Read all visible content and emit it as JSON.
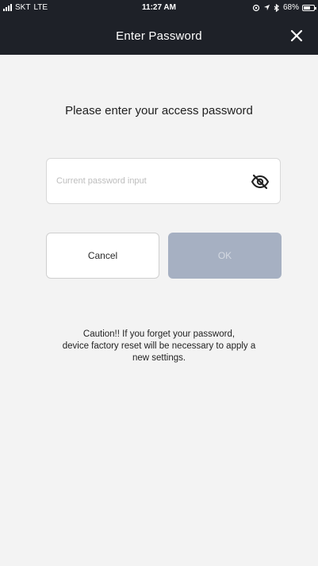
{
  "status_bar": {
    "carrier": "SKT",
    "network": "LTE",
    "time": "11:27 AM",
    "battery": "68%",
    "battery_level": 0.68
  },
  "nav": {
    "title": "Enter Password",
    "close_icon": "close-icon",
    "background_color": "#1e2128"
  },
  "main": {
    "prompt": "Please enter your access password",
    "password_input": {
      "placeholder": "Current password input",
      "value": "",
      "visibility_icon": "eye-off-icon"
    },
    "buttons": {
      "cancel_label": "Cancel",
      "ok_label": "OK",
      "ok_color": "#a6b0c2"
    },
    "caution": {
      "line1": "Caution!! If you forget your password,",
      "line2": "device factory reset  will be necessary to apply a",
      "line3": "new settings."
    }
  }
}
